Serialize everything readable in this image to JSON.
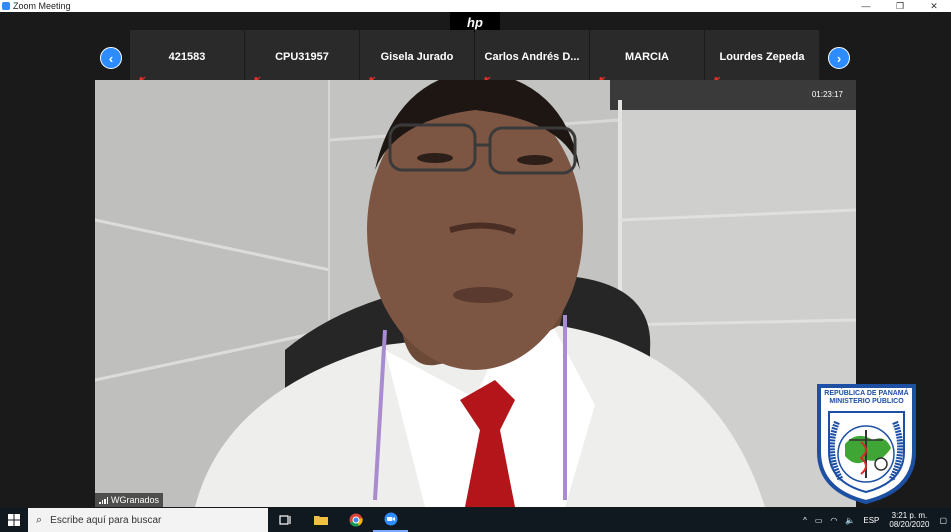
{
  "window": {
    "title": "Zoom Meeting",
    "minimize": "—",
    "restore": "❐",
    "close": "✕"
  },
  "brand": {
    "logo_text": "hp"
  },
  "gallery": {
    "prev_glyph": "‹",
    "next_glyph": "›",
    "participants": [
      {
        "name": "421583",
        "muted": true
      },
      {
        "name": "CPU31957",
        "muted": true
      },
      {
        "name": "Gisela Jurado",
        "muted": true
      },
      {
        "name": "Carlos Andrés D...",
        "muted": true
      },
      {
        "name": "MARCIA",
        "muted": true
      },
      {
        "name": "Lourdes Zepeda",
        "muted": true
      }
    ]
  },
  "active_speaker": {
    "name": "WGranados",
    "elapsed": "01:23:17"
  },
  "seal": {
    "line1": "REPÚBLICA DE PANAMÁ",
    "line2": "MINISTERIO PÚBLICO",
    "ring_text": "INSTITUTO DE MEDICINA LEGAL Y CIENCIAS FORENSES"
  },
  "taskbar": {
    "search_placeholder": "Escribe aquí para buscar",
    "language": "ESP",
    "time": "3:21 p. m.",
    "date": "08/20/2020"
  },
  "colors": {
    "accent": "#2d8cff",
    "muted_icon": "#e0302a",
    "taskbar": "#101820"
  }
}
